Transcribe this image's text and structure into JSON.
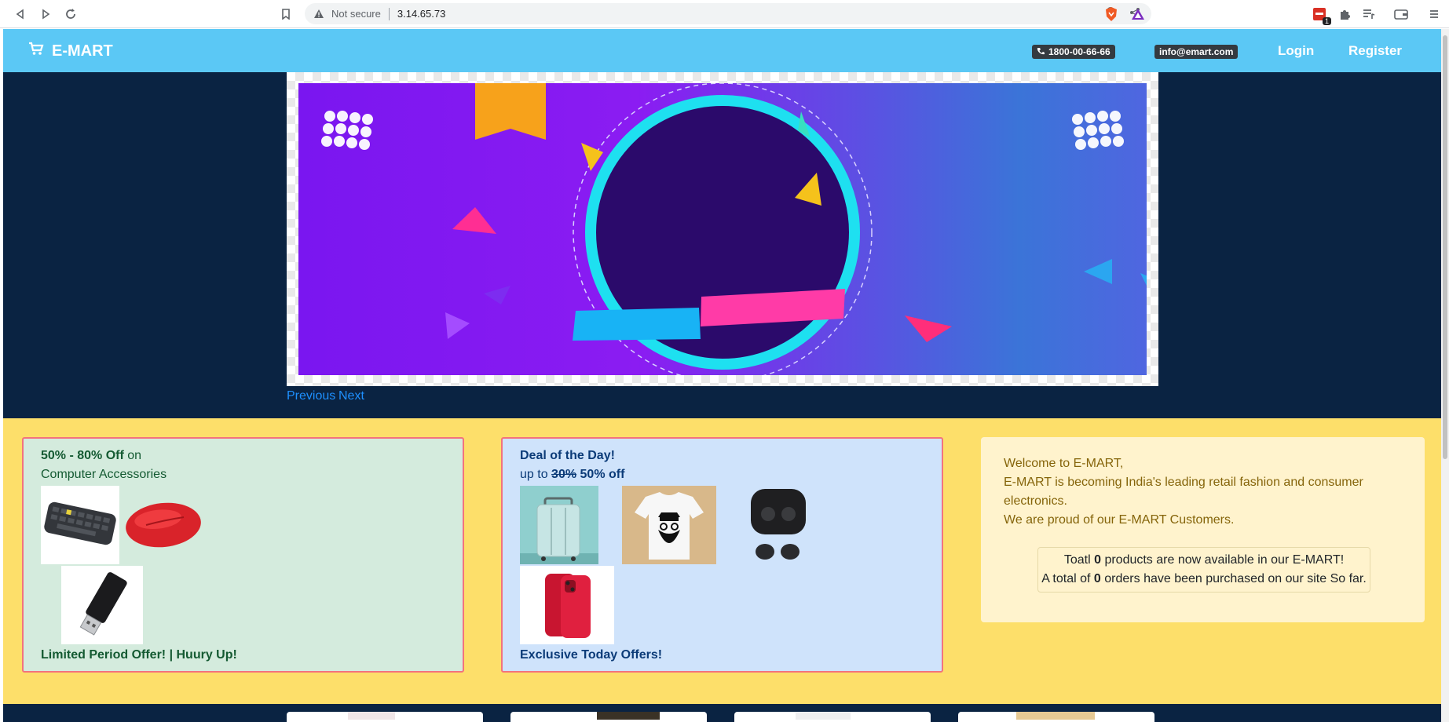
{
  "browser": {
    "security_label": "Not secure",
    "url": "3.14.65.73",
    "extension_badge": "1"
  },
  "site": {
    "brand": "E-MART",
    "phone": "1800-00-66-66",
    "email": "info@emart.com",
    "login": "Login",
    "register": "Register"
  },
  "carousel": {
    "previous": "Previous",
    "next": "Next"
  },
  "offer_accessories": {
    "highlight": "50% - 80% Off",
    "on": "on",
    "category": "Computer Accessories",
    "footer": "Limited Period Offer! | Huury Up!"
  },
  "offer_deal": {
    "title": "Deal of the Day!",
    "up_to": "up to",
    "old_discount": "30%",
    "new_discount": "50% off",
    "footer": "Exclusive Today Offers!"
  },
  "welcome": {
    "line1": "Welcome to E-MART,",
    "line2": "E-MART is becoming India's leading retail fashion and consumer",
    "line3": "electronics.",
    "line4": "We are proud of our E-MART Customers.",
    "stats_prefix1": "Toatl",
    "products_count": "0",
    "stats_suffix1": "products are now available in our E-MART!",
    "stats_prefix2": "A total of",
    "orders_count": "0",
    "stats_suffix2": "orders have been purchased on our site So far."
  },
  "colors": {
    "header": "#5bc8f5",
    "hero_bg": "#0a2342",
    "offers_bg": "#fddf6a",
    "card_border": "#f3737d"
  }
}
